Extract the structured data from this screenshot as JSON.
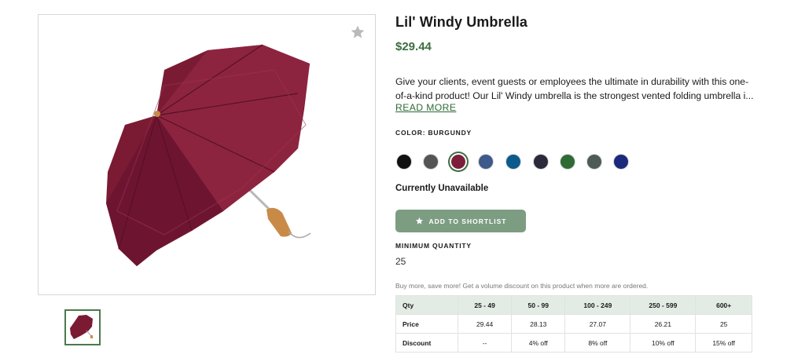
{
  "product": {
    "title": "Lil' Windy Umbrella",
    "price": "$29.44",
    "description": "Give your clients, event guests or employees the ultimate in durability with this one-of-a-kind product! Our Lil' Windy umbrella is the strongest vented folding umbrella i...",
    "read_more": "READ MORE"
  },
  "gallery": {
    "main_image_icon": "burgundy-umbrella-image",
    "favorite_icon": "star-icon",
    "thumbnail_icon": "burgundy-umbrella-thumbnail"
  },
  "color": {
    "label": "COLOR: BURGUNDY",
    "selected": "Burgundy",
    "swatches": [
      "#111111",
      "#555555",
      "#7d1f3a",
      "#3d5a8a",
      "#0b5a8c",
      "#2a2a3a",
      "#2f6b35",
      "#4d5a58",
      "#1b2a7a"
    ]
  },
  "availability": "Currently Unavailable",
  "shortlist_button": {
    "label": "ADD TO SHORTLIST",
    "icon": "star-icon"
  },
  "minimum_quantity": {
    "label": "MINIMUM QUANTITY",
    "value": "25"
  },
  "volume_note": "Buy more, save more! Get a volume discount on this product when more are ordered.",
  "pricing_table": {
    "headers": [
      "Qty",
      "25 - 49",
      "50 - 99",
      "100 - 249",
      "250 - 599",
      "600+"
    ],
    "rows": [
      {
        "label": "Price",
        "cells": [
          "29.44",
          "28.13",
          "27.07",
          "26.21",
          "25"
        ]
      },
      {
        "label": "Discount",
        "cells": [
          "--",
          "4% off",
          "8% off",
          "10% off",
          "15% off"
        ]
      }
    ]
  }
}
